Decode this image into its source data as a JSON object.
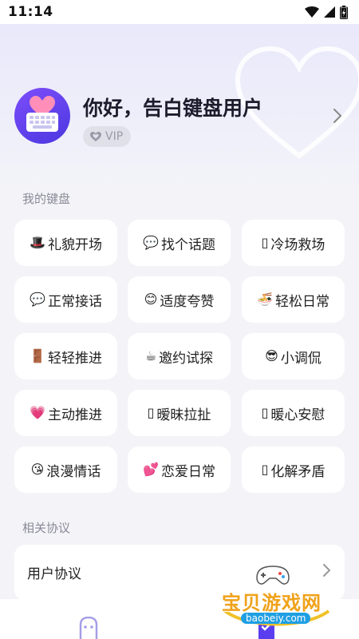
{
  "status_bar": {
    "time": "11:14"
  },
  "profile": {
    "greeting": "你好，告白键盘用户",
    "vip_label": "VIP"
  },
  "sections": {
    "my_keyboard": "我的键盘",
    "related_agreements": "相关协议"
  },
  "keyboards": [
    {
      "icon": "top-hat-icon",
      "emoji": "🎩",
      "label": "礼貌开场"
    },
    {
      "icon": "speech-bubble-icon",
      "emoji": "💬",
      "label": "找个话题"
    },
    {
      "icon": "missing-glyph-icon",
      "emoji": "▯",
      "label": "冷场救场"
    },
    {
      "icon": "speech-bubble-icon",
      "emoji": "💬",
      "label": "正常接话"
    },
    {
      "icon": "blushing-face-icon",
      "emoji": "😊",
      "label": "适度夸赞"
    },
    {
      "icon": "noodle-bowl-icon",
      "emoji": "🍜",
      "label": "轻松日常"
    },
    {
      "icon": "door-icon",
      "emoji": "🚪",
      "label": "轻轻推进"
    },
    {
      "icon": "hot-drink-icon",
      "emoji": "☕",
      "label": "邀约试探"
    },
    {
      "icon": "sunglasses-face-icon",
      "emoji": "😎",
      "label": "小调侃"
    },
    {
      "icon": "heart-icon",
      "emoji": "💗",
      "label": "主动推进"
    },
    {
      "icon": "missing-glyph-icon",
      "emoji": "▯",
      "label": "暧昧拉扯"
    },
    {
      "icon": "missing-glyph-icon",
      "emoji": "▯",
      "label": "暖心安慰"
    },
    {
      "icon": "kissing-face-icon",
      "emoji": "😘",
      "label": "浪漫情话"
    },
    {
      "icon": "two-hearts-icon",
      "emoji": "💕",
      "label": "恋爱日常"
    },
    {
      "icon": "missing-glyph-icon",
      "emoji": "▯",
      "label": "化解矛盾"
    }
  ],
  "agreements": [
    {
      "label": "用户协议"
    }
  ],
  "watermark": {
    "text": "宝贝游戏网",
    "url": "baobeiy.com"
  },
  "colors": {
    "accent": "#5b3df0",
    "badge_bg": "#e0e0e8",
    "watermark_orange": "#f0a21a"
  }
}
